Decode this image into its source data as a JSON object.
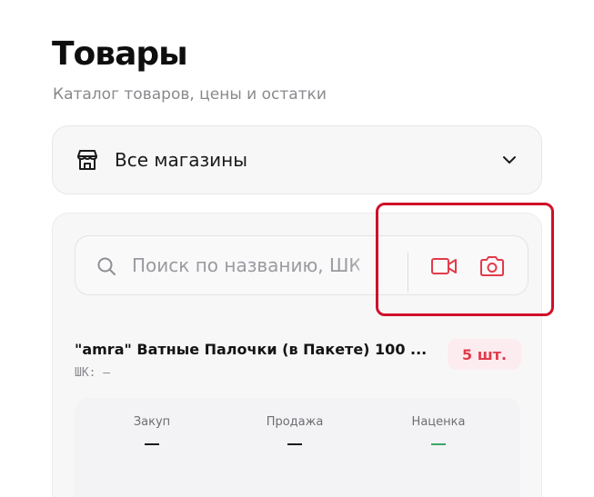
{
  "header": {
    "title": "Товары",
    "subtitle": "Каталог товаров, цены и остатки"
  },
  "store_select": {
    "label": "Все магазины",
    "icon": "store-icon"
  },
  "search": {
    "placeholder": "Поиск по названию, ШК",
    "value": "",
    "video_icon": "video-camera-icon",
    "photo_icon": "camera-icon"
  },
  "product": {
    "name": "\"amra\" Ватные Палочки (в Пакете) 100 ...",
    "barcode_label": "ШК: —",
    "stock": "5 шт."
  },
  "stats": [
    {
      "label": "Закуп",
      "value": "—"
    },
    {
      "label": "Продажа",
      "value": "—"
    },
    {
      "label": "Наценка",
      "value": "—"
    }
  ],
  "colors": {
    "accent_red": "#e23b4a",
    "highlight": "#d0102a",
    "markup_green": "#3aa869"
  }
}
